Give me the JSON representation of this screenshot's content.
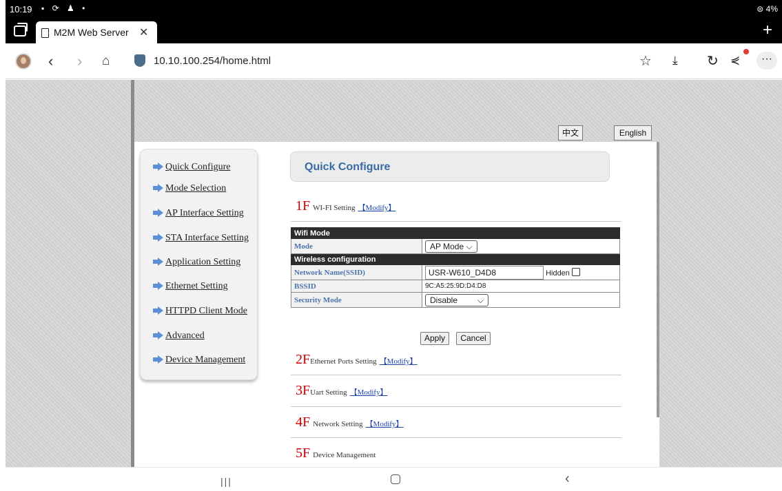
{
  "status": {
    "time": "10:19",
    "battery": "⊜ 4%"
  },
  "browser": {
    "tab_title": "M2M Web Server",
    "url": "10.10.100.254/home.html"
  },
  "page": {
    "lang_cn": "中文",
    "lang_en": "English",
    "title": "Quick Configure"
  },
  "nav": [
    "Quick Configure",
    "Mode Selection",
    "AP Interface Setting",
    "STA Interface Setting",
    "Application Setting",
    "Ethernet Setting",
    "HTTPD Client Mode",
    "Advanced",
    "Device Management"
  ],
  "sections": [
    {
      "num": "1F",
      "label": "WI-FI Setting",
      "modify": "【Modify】"
    },
    {
      "num": "2F",
      "label": "Ethernet Ports Setting",
      "modify": "【Modify】"
    },
    {
      "num": "3F",
      "label": "Uart Setting",
      "modify": "【Modify】"
    },
    {
      "num": "4F",
      "label": "Network Setting",
      "modify": "【Modify】"
    },
    {
      "num": "5F",
      "label": "Device Management"
    }
  ],
  "wifi": {
    "mode_header": "Wifi Mode",
    "mode_label": "Mode",
    "mode_value": "AP Mode",
    "wireless_header": "Wireless configuration",
    "ssid_label": "Network Name(SSID)",
    "ssid_value": "USR-W610_D4D8",
    "hidden_label": "Hidden",
    "bssid_label": "BSSID",
    "bssid_value": "9C:A5:25:9D:D4:D8",
    "security_label": "Security Mode",
    "security_value": "Disable",
    "apply_label": "Apply",
    "cancel_label": "Cancel"
  }
}
